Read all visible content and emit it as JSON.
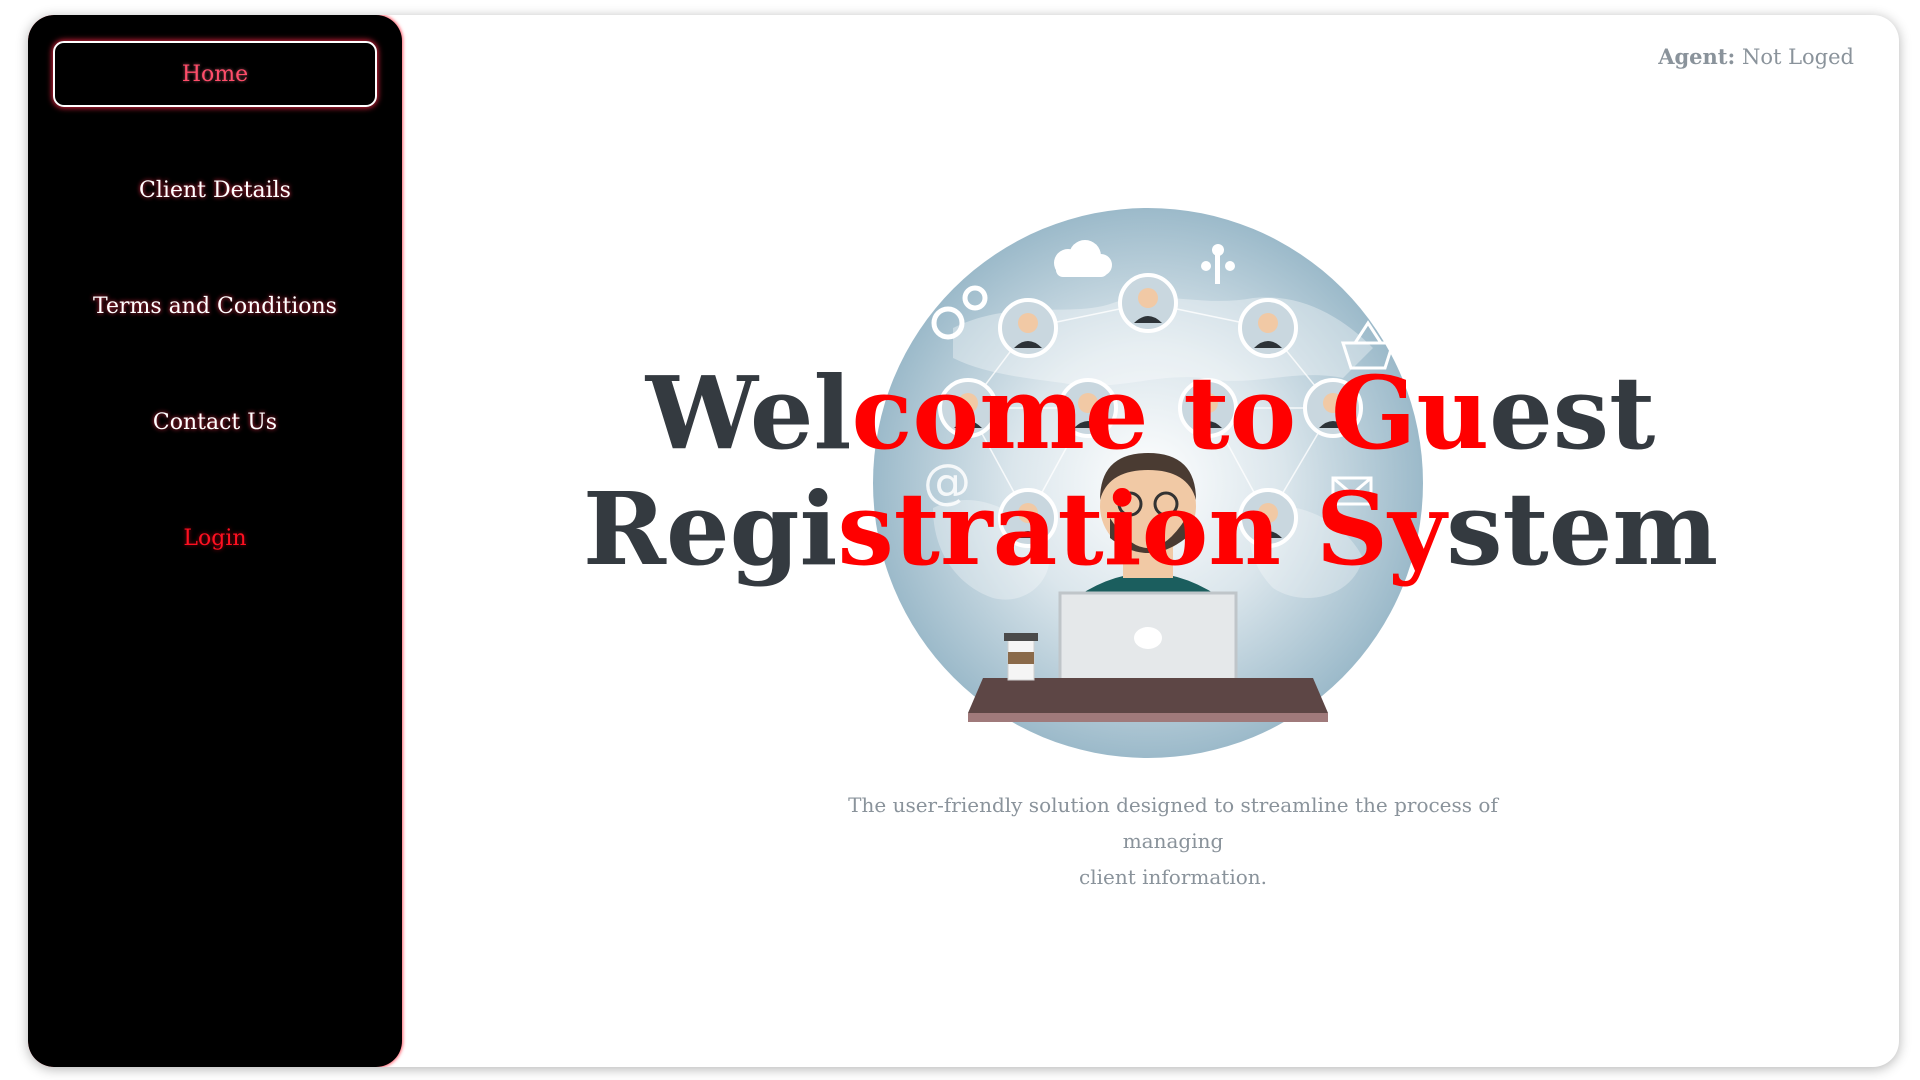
{
  "sidebar": {
    "items": [
      {
        "label": "Home",
        "active": true
      },
      {
        "label": "Client Details",
        "active": false
      },
      {
        "label": "Terms and Conditions",
        "active": false
      },
      {
        "label": "Contact Us",
        "active": false
      },
      {
        "label": "Login",
        "active": false
      }
    ]
  },
  "header": {
    "agent_label": "Agent:",
    "agent_value": "Not Loged"
  },
  "hero": {
    "title_line1_a": "Wel",
    "title_line1_b": "come to Gu",
    "title_line1_c": "est",
    "title_line2_a": "Regi",
    "title_line2_b": "stration Sy",
    "title_line2_c": "stem",
    "subtitle_line1": "The user-friendly solution designed to streamline the process of managing",
    "subtitle_line2": "client information.",
    "illustration_icons": [
      "cloud-icon",
      "gear-icon",
      "network-icon",
      "basket-icon",
      "at-sign-icon",
      "mail-icon",
      "laptop-icon",
      "coffee-cup-icon"
    ]
  },
  "colors": {
    "sidebar_bg": "#000000",
    "accent_red": "#ff0000",
    "active_nav_text": "#ff4d6a",
    "title_dark": "#343a40",
    "muted_text": "#8a939b"
  }
}
